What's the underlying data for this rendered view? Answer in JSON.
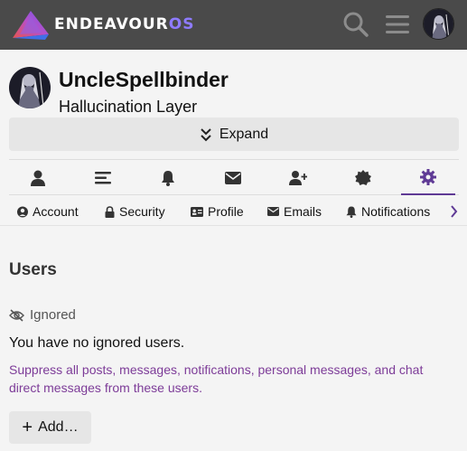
{
  "header": {
    "brand_main": "ENDEAVOUR",
    "brand_accent": "OS",
    "accent_color": "#8e7bff",
    "icons": [
      "search-icon",
      "hamburger-menu-icon",
      "user-avatar"
    ]
  },
  "profile": {
    "username": "UncleSpellbinder",
    "title": "Hallucination Layer",
    "expand_label": "Expand"
  },
  "icon_tabs": [
    "user-icon",
    "stream-icon",
    "bell-icon",
    "envelope-icon",
    "user-plus-icon",
    "badge-icon",
    "gear-icon"
  ],
  "active_icon_tab": "gear-icon",
  "active_color": "#5f3a95",
  "text_tabs": {
    "account": "Account",
    "security": "Security",
    "profile": "Profile",
    "emails": "Emails",
    "notifications": "Notifications"
  },
  "content": {
    "section_title": "Users",
    "ignored_label": "Ignored",
    "no_ignored": "You have no ignored users.",
    "description": "Suppress all posts, messages, notifications, personal messages, and chat direct messages from these users.",
    "add_label": "Add…",
    "description_color": "#7d3c98"
  }
}
